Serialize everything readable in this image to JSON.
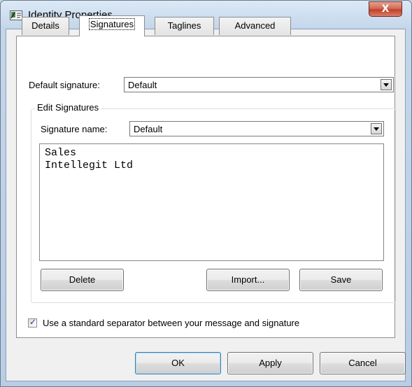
{
  "window": {
    "title": "Identity Properties",
    "close_label": "X"
  },
  "tabs": [
    {
      "label": "Details",
      "active": false
    },
    {
      "label": "Signatures",
      "active": true
    },
    {
      "label": "Taglines",
      "active": false
    },
    {
      "label": "Advanced",
      "active": false
    }
  ],
  "default_signature": {
    "label": "Default signature:",
    "value": "Default"
  },
  "edit_group": {
    "label": "Edit Signatures",
    "name_label": "Signature name:",
    "name_value": "Default",
    "text_lines": [
      "Sales",
      "Intellegit Ltd"
    ],
    "delete_label": "Delete",
    "import_label": "Import...",
    "save_label": "Save"
  },
  "separator_checkbox": {
    "label": "Use a standard separator between your message and signature",
    "checked": true
  },
  "footer": {
    "ok_label": "OK",
    "apply_label": "Apply",
    "cancel_label": "Cancel"
  }
}
